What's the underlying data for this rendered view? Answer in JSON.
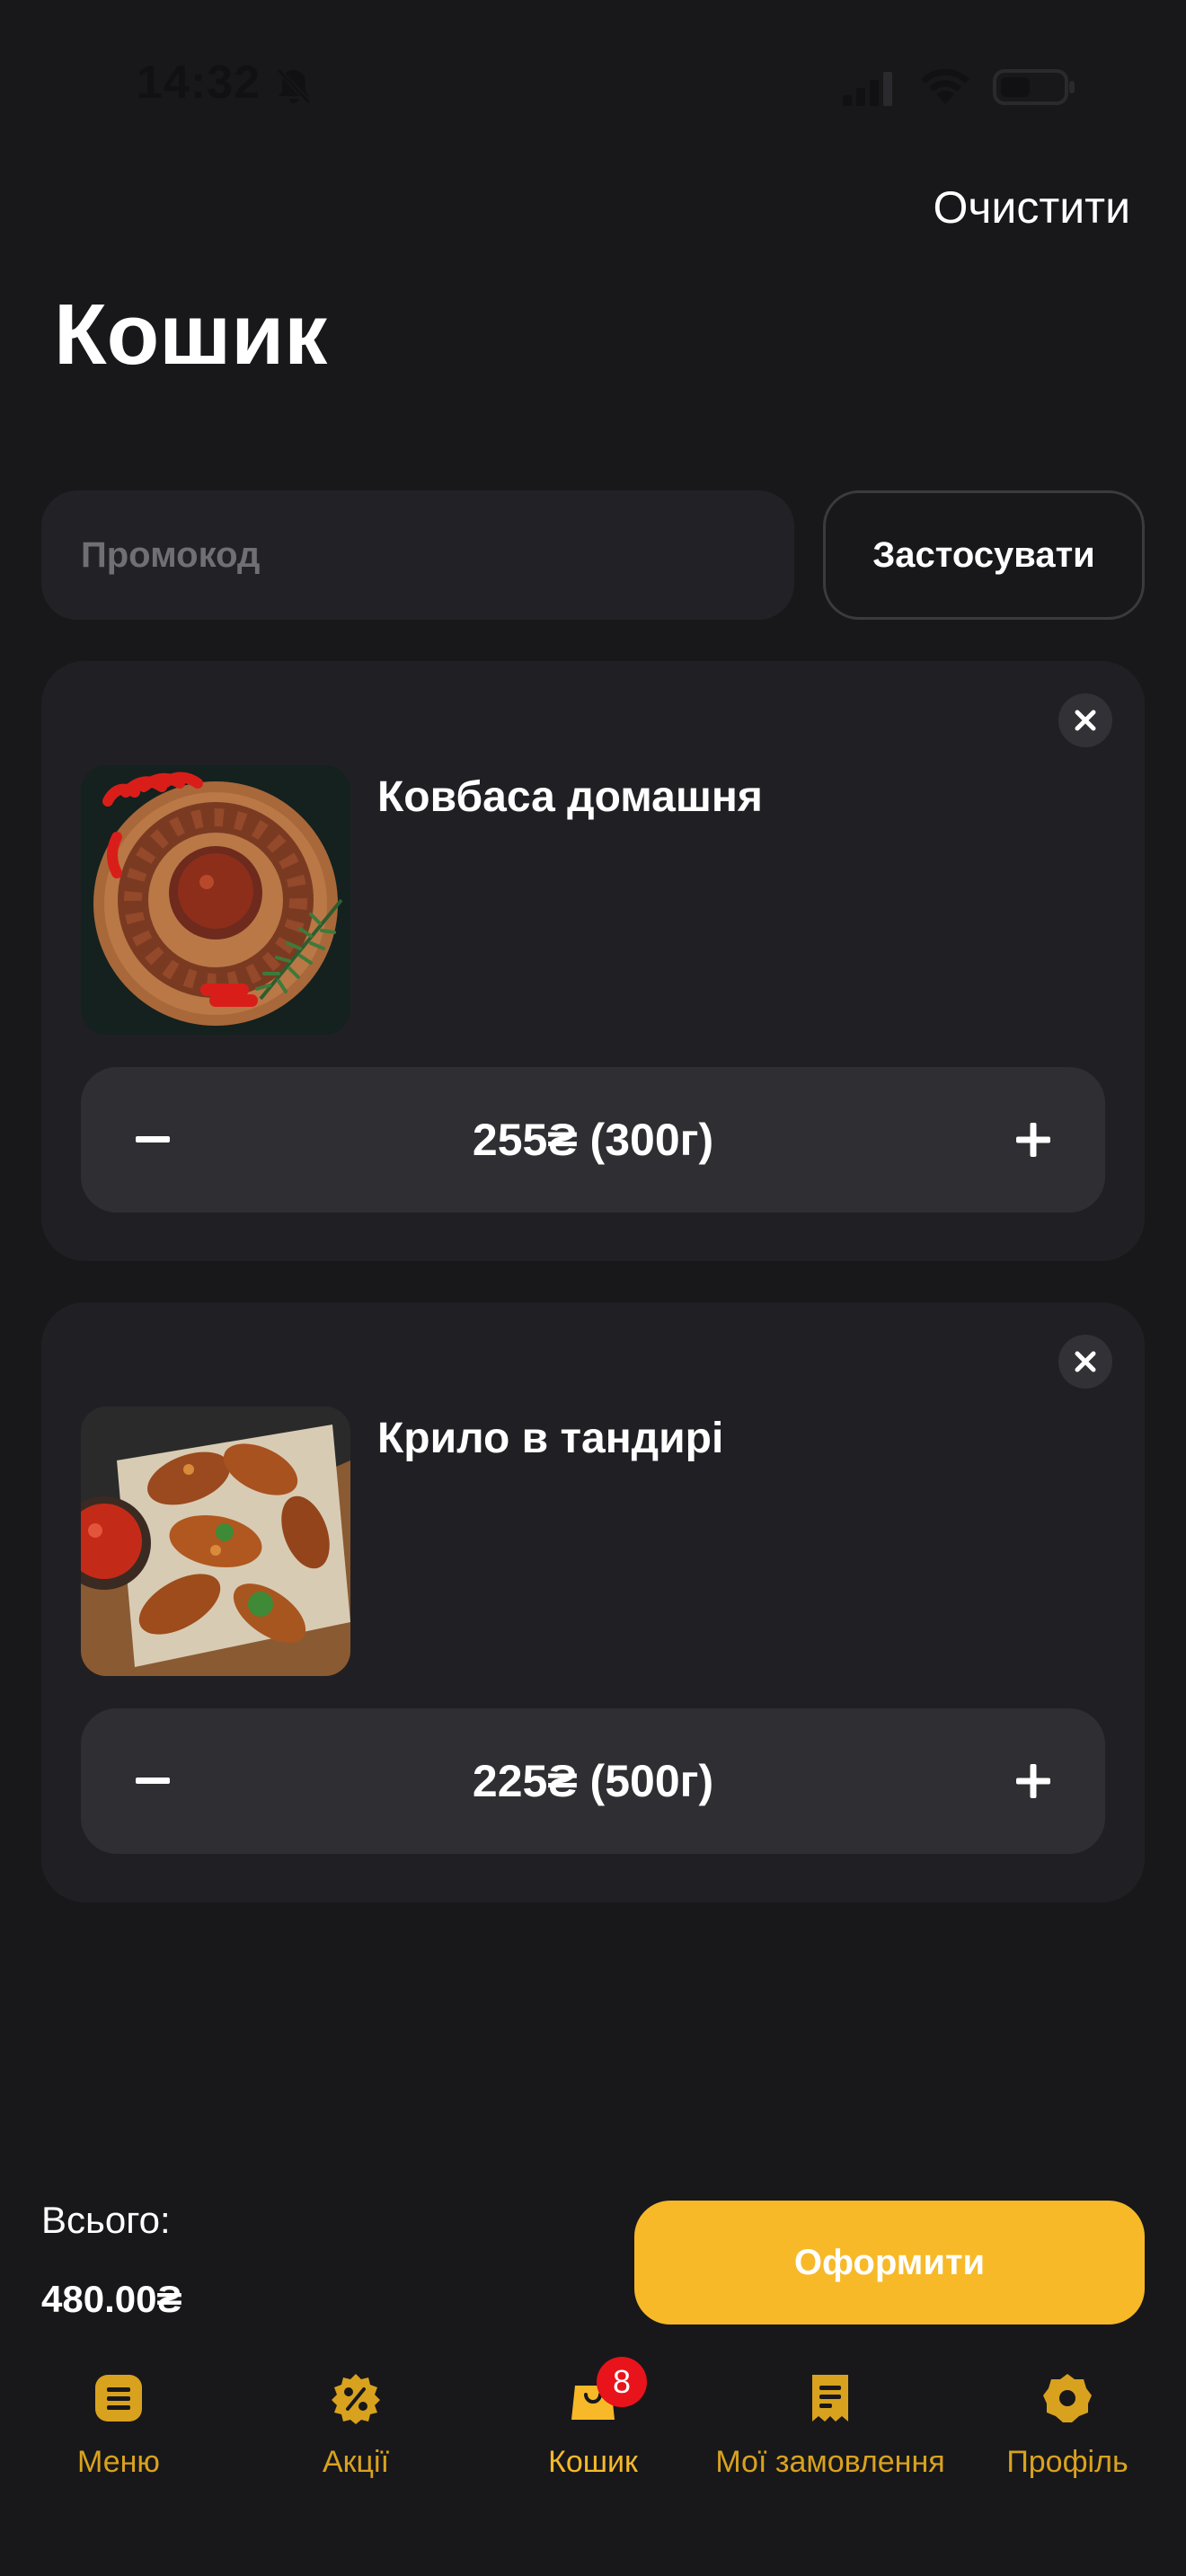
{
  "status_bar": {
    "time": "14:32",
    "icons": [
      "bell-slash-icon",
      "signal-icon",
      "wifi-icon",
      "battery-icon"
    ]
  },
  "header": {
    "clear_label": "Очистити",
    "title": "Кошик"
  },
  "promo": {
    "placeholder": "Промокод",
    "value": "",
    "apply_label": "Застосувати"
  },
  "cart": {
    "items": [
      {
        "name": "Ковбаса домашня",
        "price_label": "255₴ (300г)",
        "image": "sausage-plate-image"
      },
      {
        "name": "Крило в тандирі",
        "price_label": "225₴ (500г)",
        "image": "tandoor-wings-image"
      }
    ]
  },
  "summary": {
    "total_label": "Всього:",
    "total_value": "480.00₴",
    "checkout_label": "Оформити"
  },
  "tab_bar": {
    "tabs": [
      {
        "label": "Меню",
        "icon": "menu-icon"
      },
      {
        "label": "Акції",
        "icon": "discount-icon"
      },
      {
        "label": "Кошик",
        "icon": "cart-bag-icon",
        "badge": "8",
        "active": true
      },
      {
        "label": "Мої замовлення",
        "icon": "receipt-icon"
      },
      {
        "label": "Профіль",
        "icon": "profile-icon"
      }
    ]
  },
  "colors": {
    "background": "#18181b",
    "card": "#202024",
    "accent": "#f7b928",
    "tab_inactive": "#d9a21e",
    "badge": "#e8131b"
  }
}
